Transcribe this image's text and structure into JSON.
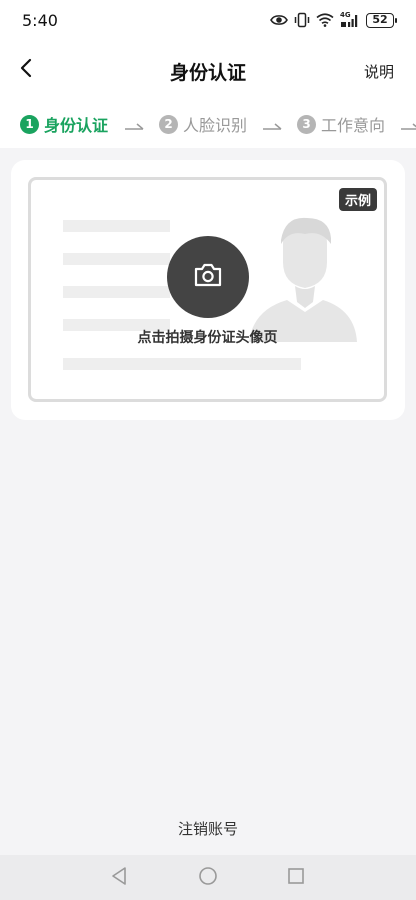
{
  "status_bar": {
    "time": "5:40",
    "battery_level": "52",
    "network_label": "4G",
    "icons": [
      "eye-icon",
      "vibrate-icon",
      "wifi-icon",
      "signal-icon",
      "battery-icon"
    ]
  },
  "header": {
    "title": "身份认证",
    "back_icon": "chevron-left-icon",
    "help_label": "说明"
  },
  "steps": [
    {
      "number": "1",
      "label": "身份认证",
      "state": "active"
    },
    {
      "number": "2",
      "label": "人脸识别",
      "state": "inactive"
    },
    {
      "number": "3",
      "label": "工作意向",
      "state": "inactive"
    }
  ],
  "id_card": {
    "example_tag": "示例",
    "capture_label": "点击拍摄身份证头像页",
    "camera_icon": "camera-icon"
  },
  "footer": {
    "cancel_account_label": "注销账号"
  },
  "nav_bar": {
    "icons": [
      "back-triangle-icon",
      "home-circle-icon",
      "recents-square-icon"
    ]
  },
  "colors": {
    "accent": "#1aa35f",
    "background": "#f4f4f6",
    "camera_button": "#444444"
  }
}
